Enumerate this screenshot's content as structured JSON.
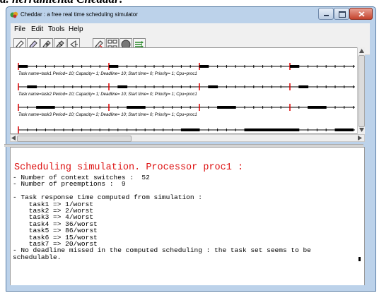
{
  "document": {
    "heading": "a. herramienta Cheddar:"
  },
  "window": {
    "title": "Cheddar : a free real time scheduling simulator"
  },
  "menu": [
    "File",
    "Edit",
    "Tools",
    "Help"
  ],
  "toolbar": {
    "icons": [
      "open-file-icon",
      "save-icon",
      "edit-icon",
      "edit-task-icon",
      "back-icon",
      "scheduling-icon",
      "network-icon",
      "simulate-icon",
      "arrows-icon"
    ]
  },
  "timeline": {
    "tasks": [
      {
        "label": "Task name=task1     Period= 10; Capacity= 1; Deadline= 10; Start time= 0; Priority= 1; Cpu=proc1",
        "period": 10,
        "capacity": 1,
        "exec": [
          [
            0,
            1
          ],
          [
            10,
            11
          ],
          [
            20,
            21
          ],
          [
            30,
            31
          ]
        ],
        "releases": [
          0,
          10,
          20,
          30
        ]
      },
      {
        "label": "Task name=task2     Period= 10; Capacity= 1; Deadline= 10; Start time= 0; Priority= 1; Cpu=proc1",
        "period": 10,
        "capacity": 1,
        "exec": [
          [
            1,
            2
          ],
          [
            11,
            12
          ],
          [
            21,
            22
          ],
          [
            31,
            32
          ]
        ],
        "releases": [
          0,
          10,
          20,
          30
        ]
      },
      {
        "label": "Task name=task3     Period= 10; Capacity= 2; Deadline= 10; Start time= 0; Priority= 1; Cpu=proc1",
        "period": 10,
        "capacity": 2,
        "exec": [
          [
            2,
            4
          ],
          [
            12,
            14
          ],
          [
            22,
            24
          ],
          [
            32,
            34
          ]
        ],
        "releases": [
          0,
          10,
          20,
          30
        ]
      },
      {
        "label": "",
        "exec": [
          [
            18,
            20
          ],
          [
            25,
            31
          ],
          [
            35,
            37
          ]
        ],
        "releases": [
          0
        ]
      }
    ]
  },
  "output": {
    "title": "Scheduling simulation. Processor proc1 :",
    "lines": [
      "- Number of context switches :  52",
      "- Number of preemptions :  9",
      "",
      "- Task response time computed from simulation :",
      "    task1 => 1/worst",
      "    task2 => 2/worst",
      "    task3 => 4/worst",
      "    task4 => 36/worst",
      "    task5 => 86/worst",
      "    task6 => 15/worst",
      "    task7 => 20/worst",
      "- No deadline missed in the computed scheduling : the task set seems to be",
      "schedulable."
    ]
  },
  "colors": {
    "release_mark": "#dd0000",
    "exec_bar": "#000000",
    "title_red": "#dd1111"
  }
}
